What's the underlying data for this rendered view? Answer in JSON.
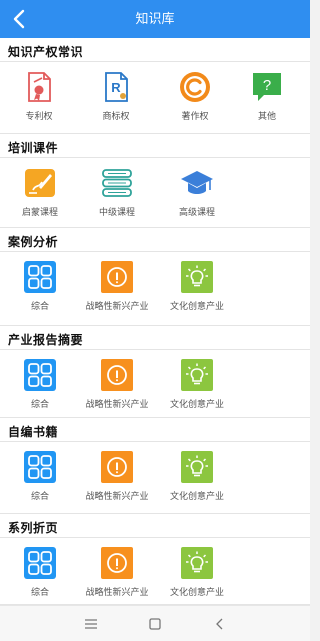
{
  "header": {
    "title": "知识库",
    "back_icon": "chevron-left-icon"
  },
  "sections": [
    {
      "title": "知识产权常识",
      "items": [
        {
          "label": "专利权",
          "icon": "patent-certificate-icon"
        },
        {
          "label": "商标权",
          "icon": "trademark-document-icon"
        },
        {
          "label": "著作权",
          "icon": "copyright-icon"
        },
        {
          "label": "其他",
          "icon": "question-bubble-icon"
        }
      ]
    },
    {
      "title": "培训课件",
      "items": [
        {
          "label": "启蒙课程",
          "icon": "writing-pen-icon"
        },
        {
          "label": "中级课程",
          "icon": "stacked-books-icon"
        },
        {
          "label": "高级课程",
          "icon": "graduation-cap-icon"
        }
      ]
    },
    {
      "title": "案例分析",
      "items": [
        {
          "label": "综合",
          "icon": "grid-icon"
        },
        {
          "label": "战略性新兴产业",
          "icon": "info-circle-icon"
        },
        {
          "label": "文化创意产业",
          "icon": "lightbulb-icon"
        }
      ]
    },
    {
      "title": "产业报告摘要",
      "items": [
        {
          "label": "综合",
          "icon": "grid-icon"
        },
        {
          "label": "战略性新兴产业",
          "icon": "info-circle-icon"
        },
        {
          "label": "文化创意产业",
          "icon": "lightbulb-icon"
        }
      ]
    },
    {
      "title": "自编书籍",
      "items": [
        {
          "label": "综合",
          "icon": "grid-icon"
        },
        {
          "label": "战略性新兴产业",
          "icon": "info-circle-icon"
        },
        {
          "label": "文化创意产业",
          "icon": "lightbulb-icon"
        }
      ]
    },
    {
      "title": "系列折页",
      "items": [
        {
          "label": "综合",
          "icon": "grid-icon"
        },
        {
          "label": "战略性新兴产业",
          "icon": "info-circle-icon"
        },
        {
          "label": "文化创意产业",
          "icon": "lightbulb-icon"
        }
      ]
    }
  ],
  "bottom_nav": [
    {
      "icon": "menu-icon"
    },
    {
      "icon": "home-square-icon"
    },
    {
      "icon": "back-arrow-icon"
    }
  ],
  "colors": {
    "header_blue": "#2f8ef0",
    "patent_red": "#e25b5b",
    "trademark_blue": "#2a78c8",
    "copyright_orange": "#f28a1a",
    "other_green": "#3aae4a",
    "course_orange": "#f5a623",
    "books_teal": "#2fa39a",
    "cap_blue": "#3b7fd9",
    "grid_blue": "#2196f3",
    "info_orange": "#f7901e",
    "bulb_green": "#8cc63f"
  }
}
